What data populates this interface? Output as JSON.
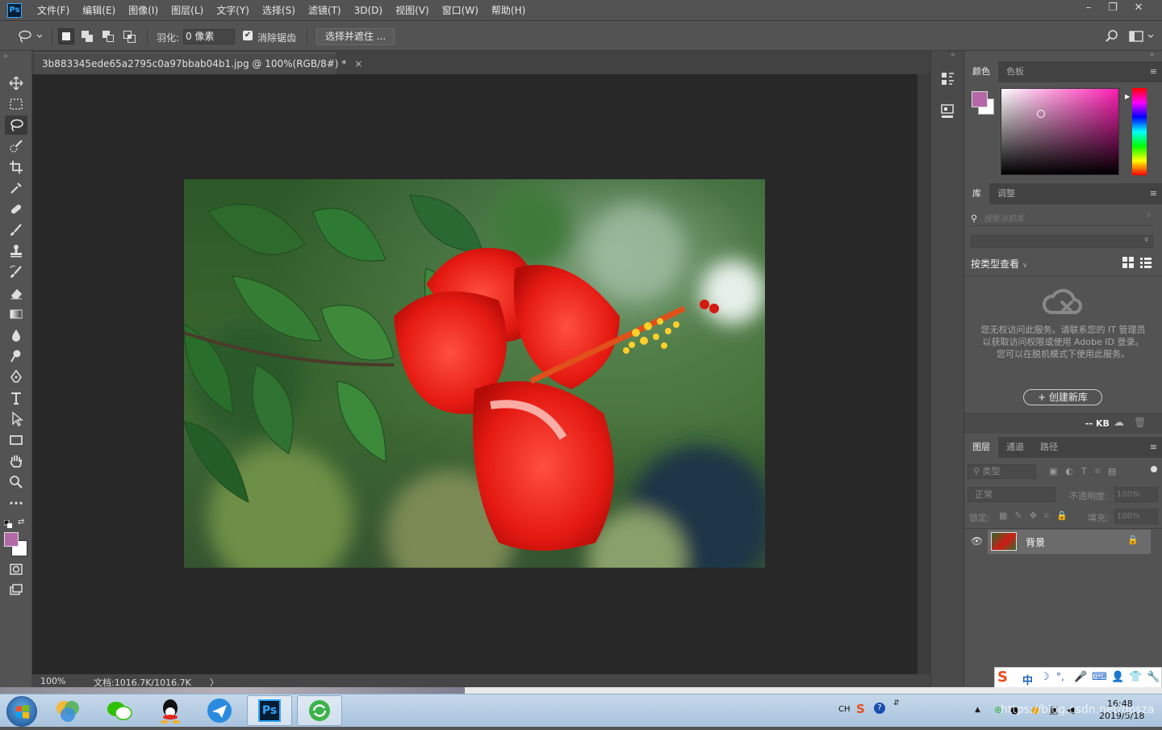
{
  "menu": {
    "app_icon": "Ps",
    "items": [
      "文件(F)",
      "编辑(E)",
      "图像(I)",
      "图层(L)",
      "文字(Y)",
      "选择(S)",
      "滤镜(T)",
      "3D(D)",
      "视图(V)",
      "窗口(W)",
      "帮助(H)"
    ]
  },
  "options": {
    "feather_label": "羽化:",
    "feather_value": "0 像素",
    "antialias_label": "消除锯齿",
    "mask_button": "选择并遮住 ..."
  },
  "document": {
    "tab_title": "3b883345ede65a2795c0a97bbab04b1.jpg @ 100%(RGB/8#) *",
    "zoom": "100%",
    "doc_info": "文档:1016.7K/1016.7K",
    "status_arrow": "〉"
  },
  "color_panel": {
    "tabs": [
      "颜色",
      "色板"
    ],
    "fg_color": "#b468a8",
    "bg_color": "#ffffff",
    "hue_color": "#ff1fb4"
  },
  "library_panel": {
    "tabs": [
      "库",
      "调整"
    ],
    "search_placeholder": "搜索当前库",
    "view_label": "按类型查看",
    "message": "您无权访问此服务。请联系您的 IT 管理员以获取访问权限或使用 Adobe ID 登录。您可以在脱机模式下使用此服务。",
    "create_button": "+ 创建新库",
    "size_label": "-- KB"
  },
  "layers_panel": {
    "tabs": [
      "图层",
      "通道",
      "路径"
    ],
    "filter_label": "类型",
    "blend_mode": "正常",
    "opacity_label": "不透明度:",
    "opacity_value": "100%",
    "lock_label": "锁定:",
    "fill_label": "填充:",
    "fill_value": "100%",
    "layers": [
      {
        "name": "背景"
      }
    ]
  },
  "ime": {
    "labels": [
      "中"
    ]
  },
  "taskbar": {
    "lang": "CH",
    "time": "16:48",
    "date": "2019/5/18",
    "watermark": "https://blog.csdn.net/qosza"
  }
}
